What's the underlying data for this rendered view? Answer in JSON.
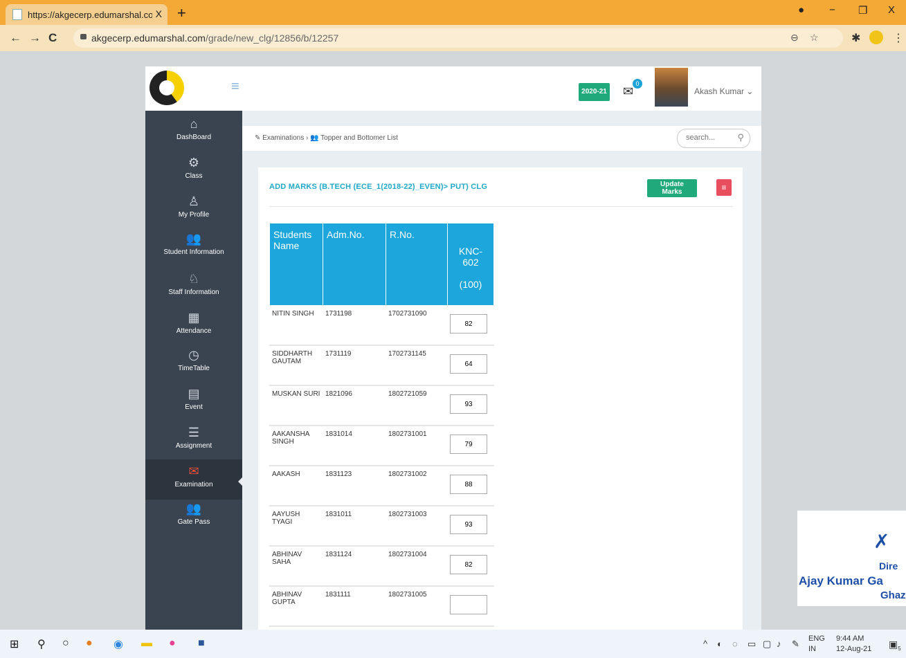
{
  "browser": {
    "tab_title": "https://akgecerp.edumarshal.com",
    "tab_close": "X",
    "new_tab": "+",
    "url_host": "akgecerp.edumarshal.com",
    "url_path": "/grade/new_clg/12856/b/12257",
    "window_controls": [
      "−",
      "❐",
      "X"
    ]
  },
  "header": {
    "year": "2020-21",
    "mail_count": "0",
    "user_name": "Akash Kumar"
  },
  "sidebar": {
    "items": [
      {
        "label": "DashBoard",
        "icon": "home-icon",
        "glyph": "⌂"
      },
      {
        "label": "Class",
        "icon": "gear-icon",
        "glyph": "⚙"
      },
      {
        "label": "My Profile",
        "icon": "user-icon",
        "glyph": "♙"
      },
      {
        "label": "Student Information",
        "icon": "users-icon",
        "glyph": "👥"
      },
      {
        "label": "Staff Information",
        "icon": "staff-icon",
        "glyph": "♘"
      },
      {
        "label": "Attendance",
        "icon": "calculator-icon",
        "glyph": "▦"
      },
      {
        "label": "TimeTable",
        "icon": "clock-icon",
        "glyph": "◷"
      },
      {
        "label": "Event",
        "icon": "calendar-icon",
        "glyph": "▤"
      },
      {
        "label": "Assignment",
        "icon": "assignment-icon",
        "glyph": "☰"
      },
      {
        "label": "Examination",
        "icon": "exam-icon",
        "glyph": "✉"
      },
      {
        "label": "Gate Pass",
        "icon": "gatepass-icon",
        "glyph": "👥"
      }
    ],
    "active": "Examination"
  },
  "breadcrumb": {
    "item1": "Examinations",
    "separator": "›",
    "item2": "Topper and Bottomer List"
  },
  "search": {
    "placeholder": "search..."
  },
  "panel": {
    "title": "ADD MARKS (B.TECH (ECE_1(2018-22)_EVEN)> PUT) CLG",
    "update_button": "Update Marks",
    "menu_button": "≡"
  },
  "table": {
    "headers": {
      "name": "Students Name",
      "adm": "Adm.No.",
      "rno": "R.No.",
      "subject": "KNC-602",
      "max": "(100)"
    },
    "rows": [
      {
        "name": "NITIN SINGH",
        "adm": "1731198",
        "rno": "1702731090",
        "marks": "82"
      },
      {
        "name": "SIDDHARTH GAUTAM",
        "adm": "1731119",
        "rno": "1702731145",
        "marks": "64"
      },
      {
        "name": "MUSKAN SURI",
        "adm": "1821096",
        "rno": "1802721059",
        "marks": "93"
      },
      {
        "name": "AAKANSHA SINGH",
        "adm": "1831014",
        "rno": "1802731001",
        "marks": "79"
      },
      {
        "name": "AAKASH",
        "adm": "1831123",
        "rno": "1802731002",
        "marks": "88"
      },
      {
        "name": "AAYUSH TYAGI",
        "adm": "1831011",
        "rno": "1802731003",
        "marks": "93"
      },
      {
        "name": "ABHINAV SAHA",
        "adm": "1831124",
        "rno": "1802731004",
        "marks": "82"
      },
      {
        "name": "ABHINAV GUPTA",
        "adm": "1831111",
        "rno": "1802731005",
        "marks": ""
      }
    ]
  },
  "signature": {
    "line1": "Dire",
    "line2": "Ajay Kumar Ga",
    "line3": "Ghaz"
  },
  "taskbar": {
    "lang_top": "ENG",
    "lang_bottom": "IN",
    "time": "9:44 AM",
    "date": "12-Aug-21",
    "notification_count": "5"
  }
}
